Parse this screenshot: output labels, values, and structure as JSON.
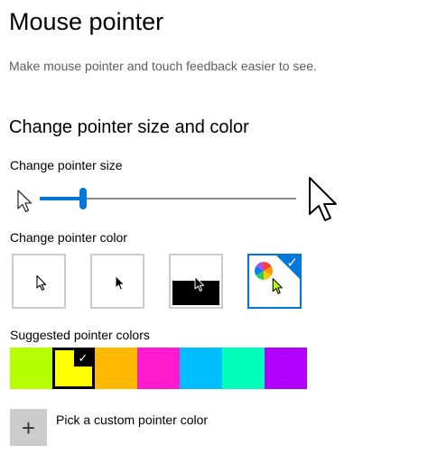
{
  "page": {
    "title": "Mouse pointer",
    "subtitle": "Make mouse pointer and touch feedback easier to see."
  },
  "section": {
    "title": "Change pointer size and color"
  },
  "pointer_size": {
    "label": "Change pointer size",
    "value_fraction": 0.16,
    "small_icon": "small-pointer-icon",
    "large_icon": "large-pointer-icon"
  },
  "pointer_color": {
    "label": "Change pointer color",
    "options": [
      {
        "id": "white",
        "icon": "white-pointer-icon",
        "selected": false
      },
      {
        "id": "black",
        "icon": "black-pointer-icon",
        "selected": false
      },
      {
        "id": "inverted",
        "icon": "inverted-pointer-icon",
        "selected": false
      },
      {
        "id": "custom",
        "icon": "custom-color-pointer-icon",
        "selected": true
      }
    ]
  },
  "suggested": {
    "label": "Suggested pointer colors",
    "colors": [
      "#b5ff00",
      "#ffff00",
      "#ffb900",
      "#ff1acd",
      "#00bfff",
      "#00ffbb",
      "#b200ff"
    ],
    "selected_index": 1,
    "check_glyph": "✓"
  },
  "custom": {
    "label": "Pick a custom pointer color",
    "button_glyph": "+"
  },
  "colors": {
    "accent": "#0078d7",
    "selected_pointer": "#ffff00",
    "border_gray": "#cccccc"
  }
}
